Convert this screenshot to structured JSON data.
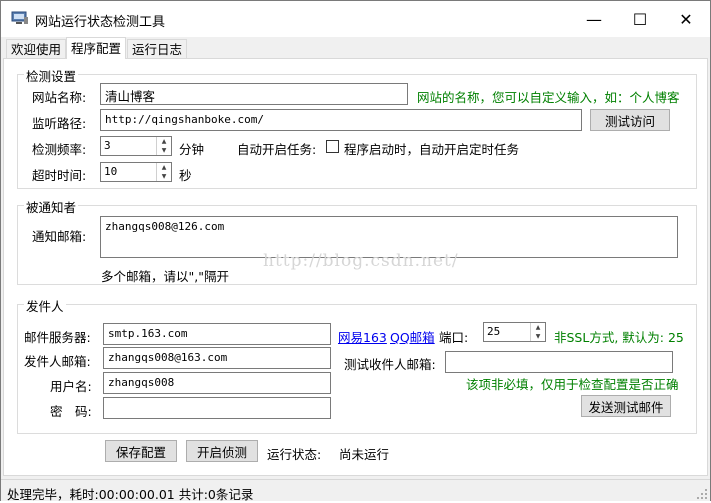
{
  "window": {
    "title": "网站运行状态检测工具",
    "minimize_glyph": "—",
    "maximize_glyph": "☐",
    "close_glyph": "✕"
  },
  "tabs": [
    {
      "label": "欢迎使用"
    },
    {
      "label": "程序配置"
    },
    {
      "label": "运行日志"
    }
  ],
  "detect": {
    "title": "检测设置",
    "site_name_label": "网站名称:",
    "site_name_value": "清山博客",
    "site_name_hint": "网站的名称，您可以自定义输入，如：个人博客",
    "url_label": "监听路径:",
    "url_value": "http://qingshanboke.com/",
    "test_visit_button": "测试访问",
    "freq_label": "检测频率:",
    "freq_value": "3",
    "freq_unit": "分钟",
    "autostart_label": "自动开启任务:",
    "autostart_checkbox_label": "程序启动时，自动开启定时任务",
    "timeout_label": "超时时间:",
    "timeout_value": "10",
    "timeout_unit": "秒"
  },
  "notify": {
    "title": "被通知者",
    "email_label": "通知邮箱:",
    "email_value": "zhangqs008@126.com",
    "email_hint": "多个邮箱，请以\",\"隔开"
  },
  "sender": {
    "title": "发件人",
    "server_label": "邮件服务器:",
    "server_value": "smtp.163.com",
    "link_163": "网易163",
    "link_qq": "QQ邮箱",
    "port_label": "端口:",
    "port_value": "25",
    "port_hint": "非SSL方式, 默认为: 25",
    "sender_email_label": "发件人邮箱:",
    "sender_email_value": "zhangqs008@163.com",
    "test_receiver_label": "测试收件人邮箱:",
    "test_receiver_value": "",
    "username_label": "用户名:",
    "username_value": "zhangqs008",
    "optional_hint": "该项非必填，仅用于检查配置是否正确",
    "password_label": "密　码:",
    "password_value": "",
    "send_test_button": "发送测试邮件"
  },
  "actions": {
    "save_button": "保存配置",
    "start_button": "开启侦测",
    "status_label": "运行状态:",
    "status_value": "尚未运行"
  },
  "watermark": "http://blog.csdn.net/",
  "statusbar": {
    "text": "处理完毕，耗时:00:00:00.01 共计:0条记录"
  },
  "colors": {
    "hint_green": "#008000",
    "link_blue": "#0000ee"
  }
}
